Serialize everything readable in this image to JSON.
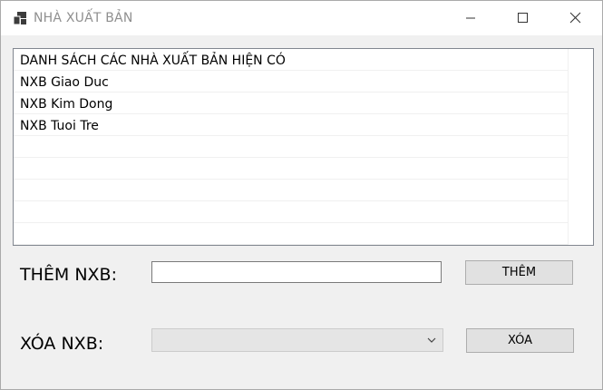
{
  "window": {
    "title": "NHÀ XUẤT BẢN",
    "icon": "app-form-icon"
  },
  "titlebar_buttons": [
    "minimize-icon",
    "maximize-icon",
    "close-icon"
  ],
  "listbox": {
    "items": [
      "DANH SÁCH CÁC NHÀ XUẤT BẢN HIỆN CÓ",
      "NXB Giao Duc",
      "NXB Kim Dong",
      "NXB Tuoi Tre"
    ]
  },
  "add": {
    "label": "THÊM NXB:",
    "input_value": "",
    "button_label": "THÊM"
  },
  "remove": {
    "label": "XÓA NXB:",
    "selected_value": "",
    "button_label": "XÓA"
  },
  "colors": {
    "window_bg": "#f0f0f0",
    "titlebar_bg": "#ffffff",
    "title_text": "#8f8f8f",
    "button_bg": "#e1e1e1",
    "button_border": "#adadad",
    "combo_bg": "#e5e5e5"
  }
}
